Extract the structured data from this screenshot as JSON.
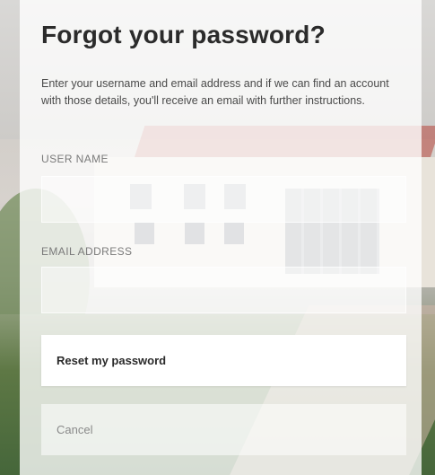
{
  "form": {
    "title": "Forgot your password?",
    "description": "Enter your username and email address and if we can find an account with those details, you'll receive an email with further instructions.",
    "username_label": "USER NAME",
    "username_value": "",
    "email_label": "EMAIL ADDRESS",
    "email_value": "",
    "reset_label": "Reset my password",
    "cancel_label": "Cancel"
  },
  "colors": {
    "panel": "#ffffff",
    "title_text": "#2b2b2b",
    "label_text": "#7a7a7a"
  }
}
